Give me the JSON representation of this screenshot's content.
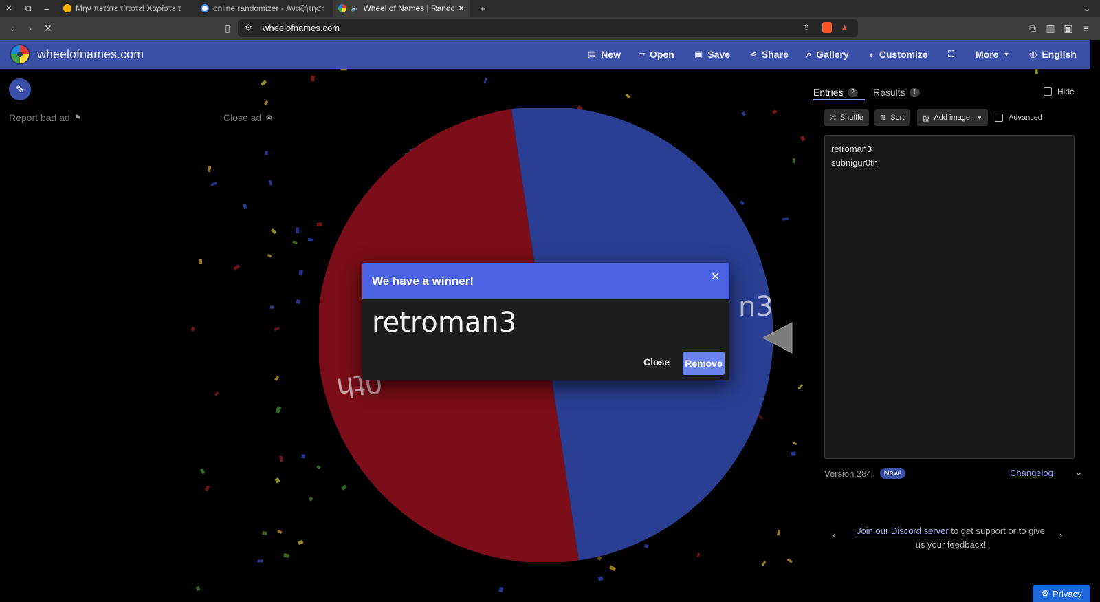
{
  "browser": {
    "tabs": [
      {
        "title": "Μην πετάτε τίποτε! Χαρίστε τ",
        "active": false
      },
      {
        "title": "online randomizer - Αναζήτηση",
        "active": false
      },
      {
        "title": "Wheel of Names | Rando",
        "active": true
      }
    ],
    "url": "wheelofnames.com"
  },
  "header": {
    "site_name": "wheelofnames.com",
    "menu": [
      "New",
      "Open",
      "Save",
      "Share",
      "Gallery",
      "Customize",
      "More",
      "English"
    ]
  },
  "ad": {
    "report_label": "Report bad ad",
    "close_label": "Close ad"
  },
  "wheel": {
    "segments": [
      {
        "label": "subnigur0th",
        "color": "#7b0e18"
      },
      {
        "label": "retroman3",
        "color": "#2a3f94"
      }
    ],
    "visible_label_fragments": [
      "n3",
      "0th"
    ]
  },
  "panel": {
    "tabs": {
      "entries": {
        "label": "Entries",
        "count": "2"
      },
      "results": {
        "label": "Results",
        "count": "1"
      }
    },
    "hide_label": "Hide",
    "tools": {
      "shuffle": "Shuffle",
      "sort": "Sort",
      "add_image": "Add image",
      "advanced": "Advanced"
    },
    "entries": [
      "retroman3",
      "subnigur0th"
    ],
    "version": "Version 284",
    "new_badge": "New!",
    "changelog": "Changelog",
    "discord_link": "Join our Discord server",
    "discord_text": " to get support or to give us your feedback!"
  },
  "privacy_label": "Privacy",
  "dialog": {
    "title": "We have a winner!",
    "winner": "retroman3",
    "close_label": "Close",
    "remove_label": "Remove"
  }
}
